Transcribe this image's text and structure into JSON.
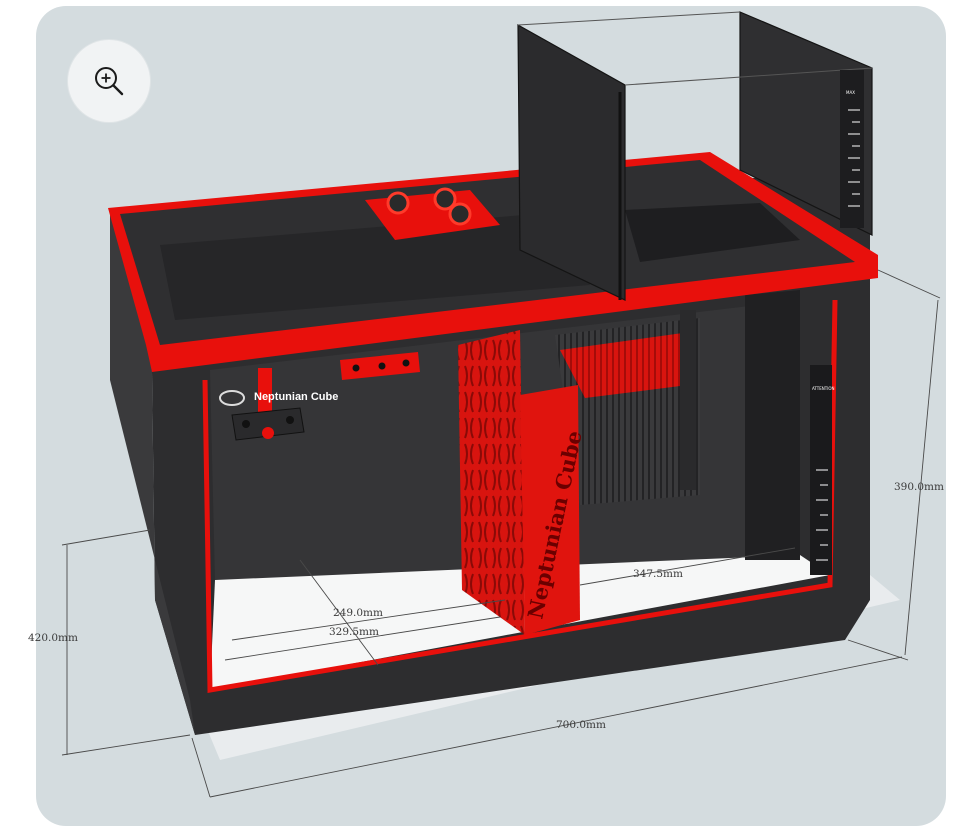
{
  "toolbar": {
    "zoom_icon": "zoom-in-icon"
  },
  "model": {
    "brand_logo": "Neptunian Cube",
    "brand_vertical": "Neptunian Cube",
    "gauge_top_label": "MAX",
    "gauge_side_label": "ATTENTION"
  },
  "dimensions": {
    "height_total": "420.0mm",
    "height_back": "390.0mm",
    "width_total": "700.0mm",
    "chamber_left_a": "249.0mm",
    "chamber_left_b": "329.5mm",
    "chamber_right": "347.5mm"
  },
  "colors": {
    "accent_red": "#e8100c",
    "body_dark": "#2c2c2e",
    "background": "#d4dcdf"
  }
}
